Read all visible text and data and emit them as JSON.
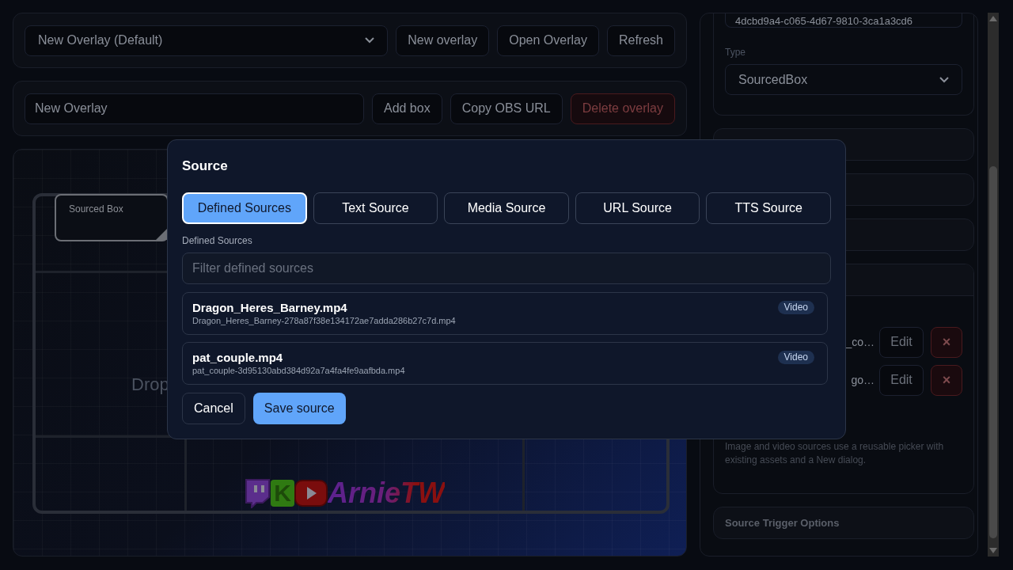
{
  "overlay_bar": {
    "select_value": "New Overlay (Default)",
    "buttons": [
      "New overlay",
      "Open Overlay",
      "Refresh"
    ]
  },
  "overlay_edit": {
    "name_value": "New Overlay",
    "buttons": [
      {
        "label": "Add box",
        "kind": "normal"
      },
      {
        "label": "Copy OBS URL",
        "kind": "normal"
      },
      {
        "label": "Delete overlay",
        "kind": "danger"
      }
    ]
  },
  "canvas": {
    "box_label": "Sourced Box",
    "drop_text": "Drop",
    "logo": {
      "mark": "K",
      "name": "ArnieTW"
    }
  },
  "inspector": {
    "id_value": "4dcbd9a4-c065-4d67-9810-3ca1a3cd6",
    "type_label": "Type",
    "type_value": "SourcedBox",
    "sources": [
      {
        "name": "_co…",
        "edit": "Edit",
        "remove": "×"
      },
      {
        "name": "go…",
        "edit": "Edit",
        "remove": "×"
      }
    ],
    "hint": "Image and video sources use a reusable picker with existing assets and a New dialog.",
    "trigger_section": "Source Trigger Options"
  },
  "dialog": {
    "title": "Source",
    "tabs": [
      {
        "label": "Defined Sources",
        "selected": true
      },
      {
        "label": "Text Source",
        "selected": false
      },
      {
        "label": "Media Source",
        "selected": false
      },
      {
        "label": "URL Source",
        "selected": false
      },
      {
        "label": "TTS Source",
        "selected": false
      }
    ],
    "list_label": "Defined Sources",
    "filter_placeholder": "Filter defined sources",
    "items": [
      {
        "name": "Dragon_Heres_Barney.mp4",
        "file": "Dragon_Heres_Barney-278a87f38e134172ae7adda286b27c7d.mp4",
        "badge": "Video"
      },
      {
        "name": "pat_couple.mp4",
        "file": "pat_couple-3d95130abd384d92a7a4fa4fe9aafbda.mp4",
        "badge": "Video"
      }
    ],
    "buttons": [
      {
        "label": "Cancel",
        "kind": "secondary"
      },
      {
        "label": "Save source",
        "kind": "primary"
      }
    ]
  }
}
